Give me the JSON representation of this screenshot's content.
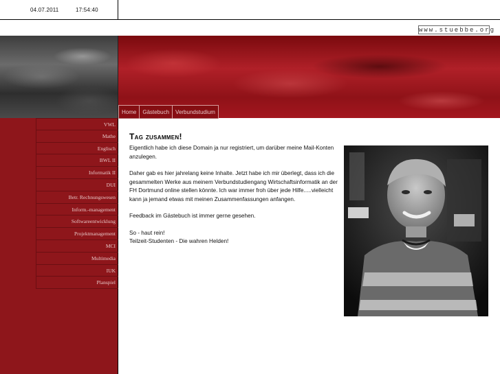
{
  "header": {
    "date": "04.07.2011",
    "time": "17:54:40",
    "site_url": "www.stuebbe.org"
  },
  "nav": {
    "items": [
      {
        "label": "Home"
      },
      {
        "label": "Gästebuch"
      },
      {
        "label": "Verbundstudium"
      }
    ]
  },
  "sidebar": {
    "items": [
      {
        "label": "VWL"
      },
      {
        "label": "Mathe"
      },
      {
        "label": "Englisch"
      },
      {
        "label": "BWL II"
      },
      {
        "label": "Informatik II"
      },
      {
        "label": "DUI"
      },
      {
        "label": "Betr. Rechnungswesen"
      },
      {
        "label": "Inform.-management"
      },
      {
        "label": "Softwareentwicklung"
      },
      {
        "label": "Projektmanagement"
      },
      {
        "label": "MCI"
      },
      {
        "label": "Multimedia"
      },
      {
        "label": "IUK"
      },
      {
        "label": "Planspiel"
      }
    ]
  },
  "main": {
    "title": "Tag zusammen!",
    "paragraphs": [
      "Eigentlich habe ich diese Domain ja nur registriert, um darüber meine Mail-Konten anzulegen.",
      "Daher gab es hier jahrelang keine Inhalte. Jetzt habe ich mir überlegt, dass ich die gesammelten Werke aus meinem Verbundstudiengang Wirtschaftsinformatik an der FH Dortmund online stellen könnte. Ich war immer froh über jede Hilfe.....vielleicht kann ja jemand etwas mit meinen Zusammenfassungen anfangen.",
      "Feedback im Gästebuch ist immer gerne gesehen.",
      "So - haut rein!",
      "Teilzeit-Studenten - Die wahren Helden!"
    ]
  },
  "colors": {
    "sidebar_red": "#8e161b",
    "header_red": "#b02028"
  }
}
